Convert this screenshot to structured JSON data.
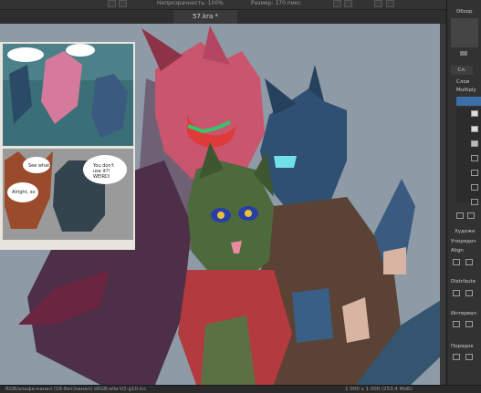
{
  "toolbar": {
    "opacity_text": "Непрозрачность: 100%",
    "size_text": "Размер: 170 пикс"
  },
  "document": {
    "tab_label": "57.kra *"
  },
  "docker": {
    "overview_label": "Обзор",
    "layers_title": "Слои",
    "layer_filter": "Сл.",
    "blend_mode": "Multiply",
    "artist_label": "Художе",
    "ordering_label": "Упорядоч",
    "align_label": "Align",
    "distribute_label": "Distribute",
    "interval_label": "Интервал",
    "order_label": "Порядок"
  },
  "status": {
    "color_profile": "RGB/альфа-канал (16-бит/канал)  sRGB-elle-V2-g10.icc",
    "dimensions": "1 000 x 1 000 (253,4 МиБ)"
  },
  "comic_panels": [
    {
      "text": "You don't use it?! Yes! Me! We look... WEIRD!"
    },
    {
      "text": "See what? Alright, so is that your first fox?"
    }
  ],
  "colors": {
    "canvas_bg": "#8e9aa6",
    "ui_dark": "#2b2b2b",
    "accent_blue": "#3d6ea8"
  }
}
